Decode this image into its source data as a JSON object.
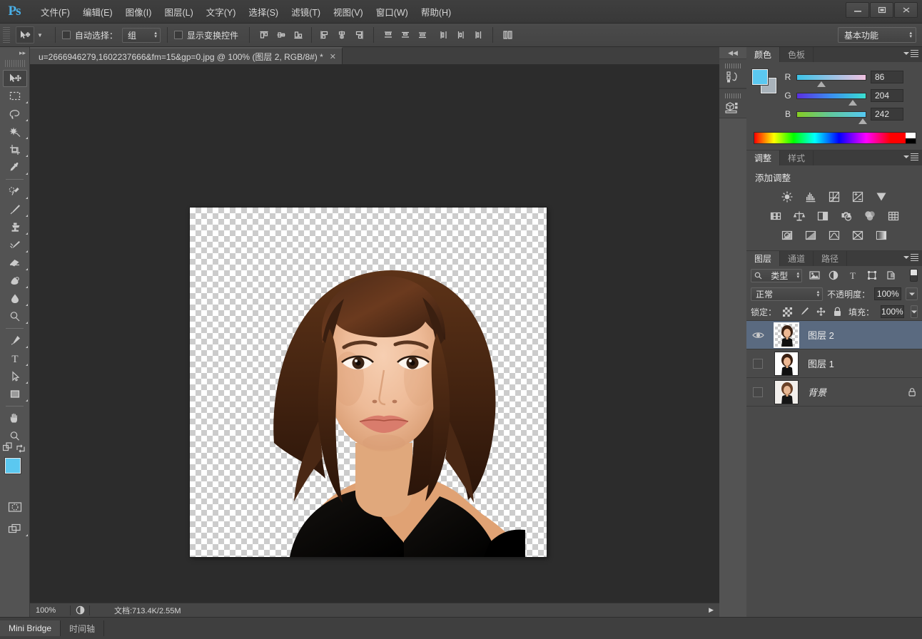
{
  "app": {
    "logo": "Ps",
    "window_controls": {
      "minimize": "–",
      "maximize": "□",
      "close": "✕"
    }
  },
  "menubar": {
    "items": [
      {
        "label": "文件(F)",
        "name": "menu-file"
      },
      {
        "label": "编辑(E)",
        "name": "menu-edit"
      },
      {
        "label": "图像(I)",
        "name": "menu-image"
      },
      {
        "label": "图层(L)",
        "name": "menu-layer"
      },
      {
        "label": "文字(Y)",
        "name": "menu-type"
      },
      {
        "label": "选择(S)",
        "name": "menu-select"
      },
      {
        "label": "滤镜(T)",
        "name": "menu-filter"
      },
      {
        "label": "视图(V)",
        "name": "menu-view"
      },
      {
        "label": "窗口(W)",
        "name": "menu-window"
      },
      {
        "label": "帮助(H)",
        "name": "menu-help"
      }
    ]
  },
  "options_bar": {
    "tool_icon": "move-tool-icon",
    "auto_select_label": "自动选择：",
    "auto_select_checked": false,
    "auto_select_target": "组",
    "show_transform_label": "显示变换控件",
    "show_transform_checked": false,
    "align_left_group": [
      "align-top-edges",
      "align-vertical-centers",
      "align-bottom-edges"
    ],
    "align_mid_group": [
      "align-left-edges",
      "align-horizontal-centers",
      "align-right-edges"
    ],
    "distribute_group_a": [
      "distribute-top-edges",
      "distribute-vertical-centers",
      "distribute-bottom-edges"
    ],
    "distribute_group_b": [
      "distribute-left-edges",
      "distribute-horizontal-centers",
      "distribute-right-edges"
    ],
    "auto_align_label": "auto-align-layers",
    "workspace": "基本功能"
  },
  "toolbar": {
    "tools": [
      {
        "name": "move-tool",
        "active": true,
        "has_flyout": false
      },
      {
        "name": "rectangular-marquee-tool",
        "active": false,
        "has_flyout": true
      },
      {
        "name": "lasso-tool",
        "active": false,
        "has_flyout": true
      },
      {
        "name": "magic-wand-tool",
        "active": false,
        "has_flyout": true
      },
      {
        "name": "crop-tool",
        "active": false,
        "has_flyout": true
      },
      {
        "name": "eyedropper-tool",
        "active": false,
        "has_flyout": true
      },
      {
        "name": "spot-healing-brush-tool",
        "active": false,
        "has_flyout": true
      },
      {
        "name": "brush-tool",
        "active": false,
        "has_flyout": true
      },
      {
        "name": "clone-stamp-tool",
        "active": false,
        "has_flyout": true
      },
      {
        "name": "history-brush-tool",
        "active": false,
        "has_flyout": true
      },
      {
        "name": "eraser-tool",
        "active": false,
        "has_flyout": true
      },
      {
        "name": "gradient-tool",
        "active": false,
        "has_flyout": true
      },
      {
        "name": "blur-tool",
        "active": false,
        "has_flyout": true
      },
      {
        "name": "dodge-tool",
        "active": false,
        "has_flyout": true
      },
      {
        "name": "pen-tool",
        "active": false,
        "has_flyout": true
      },
      {
        "name": "horizontal-type-tool",
        "active": false,
        "has_flyout": true
      },
      {
        "name": "path-selection-tool",
        "active": false,
        "has_flyout": true
      },
      {
        "name": "rectangle-tool",
        "active": false,
        "has_flyout": true
      },
      {
        "name": "hand-tool",
        "active": false,
        "has_flyout": false
      },
      {
        "name": "zoom-tool",
        "active": false,
        "has_flyout": false
      }
    ],
    "foreground_color": "#5bc8f0",
    "background_color": "#a9b3bb",
    "quick_mask_label": "edit-in-quick-mask-mode",
    "screen_mode_label": "change-screen-mode"
  },
  "document": {
    "tab_title": "u=2666946279,1602237666&fm=15&gp=0.jpg @ 100% (图层 2, RGB/8#) *",
    "close_glyph": "✕",
    "zoom": "100%",
    "doc_info": "文档:713.4K/2.55M",
    "status_arrow": "▶"
  },
  "bottom_tabs": [
    {
      "label": "Mini Bridge",
      "active": true,
      "name": "tab-mini-bridge"
    },
    {
      "label": "时间轴",
      "active": false,
      "name": "tab-timeline"
    }
  ],
  "rail": {
    "collapse_glyph": "◀◀",
    "buttons": [
      {
        "name": "history-panel-icon"
      },
      {
        "name": "3d-panel-icon"
      }
    ]
  },
  "color_panel": {
    "tabs": [
      {
        "label": "颜色",
        "active": true,
        "name": "tab-color"
      },
      {
        "label": "色板",
        "active": false,
        "name": "tab-swatches"
      }
    ],
    "foreground": "#5bc8f0",
    "background": "#a9b3bb",
    "channels": [
      {
        "label": "R",
        "value": "86",
        "pos": 34
      },
      {
        "label": "G",
        "value": "204",
        "pos": 80
      },
      {
        "label": "B",
        "value": "242",
        "pos": 95
      }
    ]
  },
  "adjustments_panel": {
    "tabs": [
      {
        "label": "调整",
        "active": true,
        "name": "tab-adjustments"
      },
      {
        "label": "样式",
        "active": false,
        "name": "tab-styles"
      }
    ],
    "title": "添加调整",
    "rows": [
      [
        "brightness-contrast-icon",
        "levels-icon",
        "curves-icon",
        "exposure-icon",
        "vibrance-icon"
      ],
      [
        "hue-saturation-icon",
        "color-balance-icon",
        "black-white-icon",
        "photo-filter-icon",
        "channel-mixer-icon",
        "color-lookup-icon"
      ],
      [
        "invert-icon",
        "posterize-icon",
        "threshold-icon",
        "selective-color-icon",
        "gradient-map-icon"
      ]
    ]
  },
  "layers_panel": {
    "tabs": [
      {
        "label": "图层",
        "active": true,
        "name": "tab-layers"
      },
      {
        "label": "通道",
        "active": false,
        "name": "tab-channels"
      },
      {
        "label": "路径",
        "active": false,
        "name": "tab-paths"
      }
    ],
    "filter_kind": "类型",
    "filter_icons": [
      "filter-pixel-layers-icon",
      "filter-adjustment-layers-icon",
      "filter-type-layers-icon",
      "filter-shape-layers-icon",
      "filter-smart-objects-icon"
    ],
    "blend_mode": "正常",
    "opacity_label": "不透明度：",
    "opacity_value": "100%",
    "lock_label": "锁定：",
    "lock_icons": [
      "lock-transparent-pixels-icon",
      "lock-image-pixels-icon",
      "lock-position-icon",
      "lock-all-icon"
    ],
    "fill_label": "填充：",
    "fill_value": "100%",
    "layers": [
      {
        "name": "图层 2",
        "visible": true,
        "selected": true,
        "locked": false,
        "transparent": true,
        "italic": false
      },
      {
        "name": "图层 1",
        "visible": false,
        "selected": false,
        "locked": false,
        "transparent": false,
        "italic": false
      },
      {
        "name": "背景",
        "visible": false,
        "selected": false,
        "locked": true,
        "transparent": false,
        "italic": true
      }
    ],
    "footer_icons": [
      "link-layers-icon",
      "layer-style-icon",
      "layer-mask-icon",
      "new-fill-adjustment-icon",
      "new-group-icon",
      "new-layer-icon",
      "delete-layer-icon"
    ]
  },
  "colors": {
    "accent_blue": "#5bc8f0",
    "selection_blue": "#5a6a80",
    "panel_bg": "#4a4a4a",
    "chrome_bg": "#535353",
    "canvas_bg": "#2c2c2c"
  }
}
